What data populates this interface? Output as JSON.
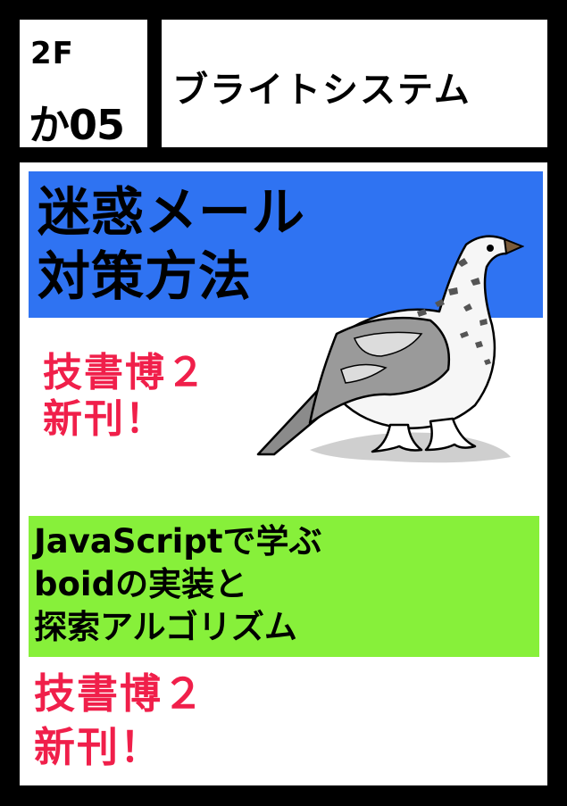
{
  "floor": {
    "line1": "2F",
    "line2": "か05"
  },
  "circle": {
    "name": "ブライトシステム"
  },
  "book1": {
    "title_line1": "迷惑メール",
    "title_line2": "対策方法",
    "badge_line1": "技書博２",
    "badge_line2": "新刊！",
    "band_color": "#2f73f2"
  },
  "book2": {
    "title_line1": "JavaScriptで学ぶ",
    "title_line2": "boidの実装と",
    "title_line3": "探索アルゴリズム",
    "badge_line1": "技書博２",
    "badge_line2": "新刊！",
    "band_color": "#87f03a"
  },
  "colors": {
    "accent": "#f01f4a",
    "background": "#000000"
  },
  "illustration": {
    "name": "ptarmigan-bird-icon"
  }
}
